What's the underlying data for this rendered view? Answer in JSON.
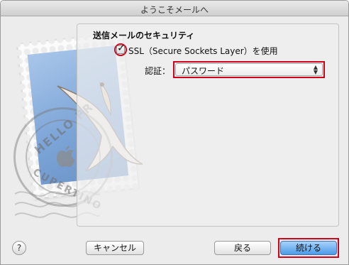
{
  "window": {
    "title": "ようこそメールへ"
  },
  "stamp": {
    "postmark_top": "HELLO FR",
    "postmark_bottom": "CUPERTINO"
  },
  "section": {
    "title": "送信メールのセキュリティ"
  },
  "ssl": {
    "label": "SSL（Secure Sockets Layer）を使用",
    "checked": true
  },
  "auth": {
    "label": "認証：",
    "selected": "パスワード"
  },
  "buttons": {
    "help": "?",
    "cancel": "キャンセル",
    "back": "戻る",
    "continue": "続ける"
  },
  "colors": {
    "highlight": "#d0021b",
    "accent": "#4c9ae8"
  },
  "icons": [
    "help-icon",
    "checkmark-icon",
    "updown-arrows-icon",
    "apple-icon",
    "hawk-icon"
  ]
}
